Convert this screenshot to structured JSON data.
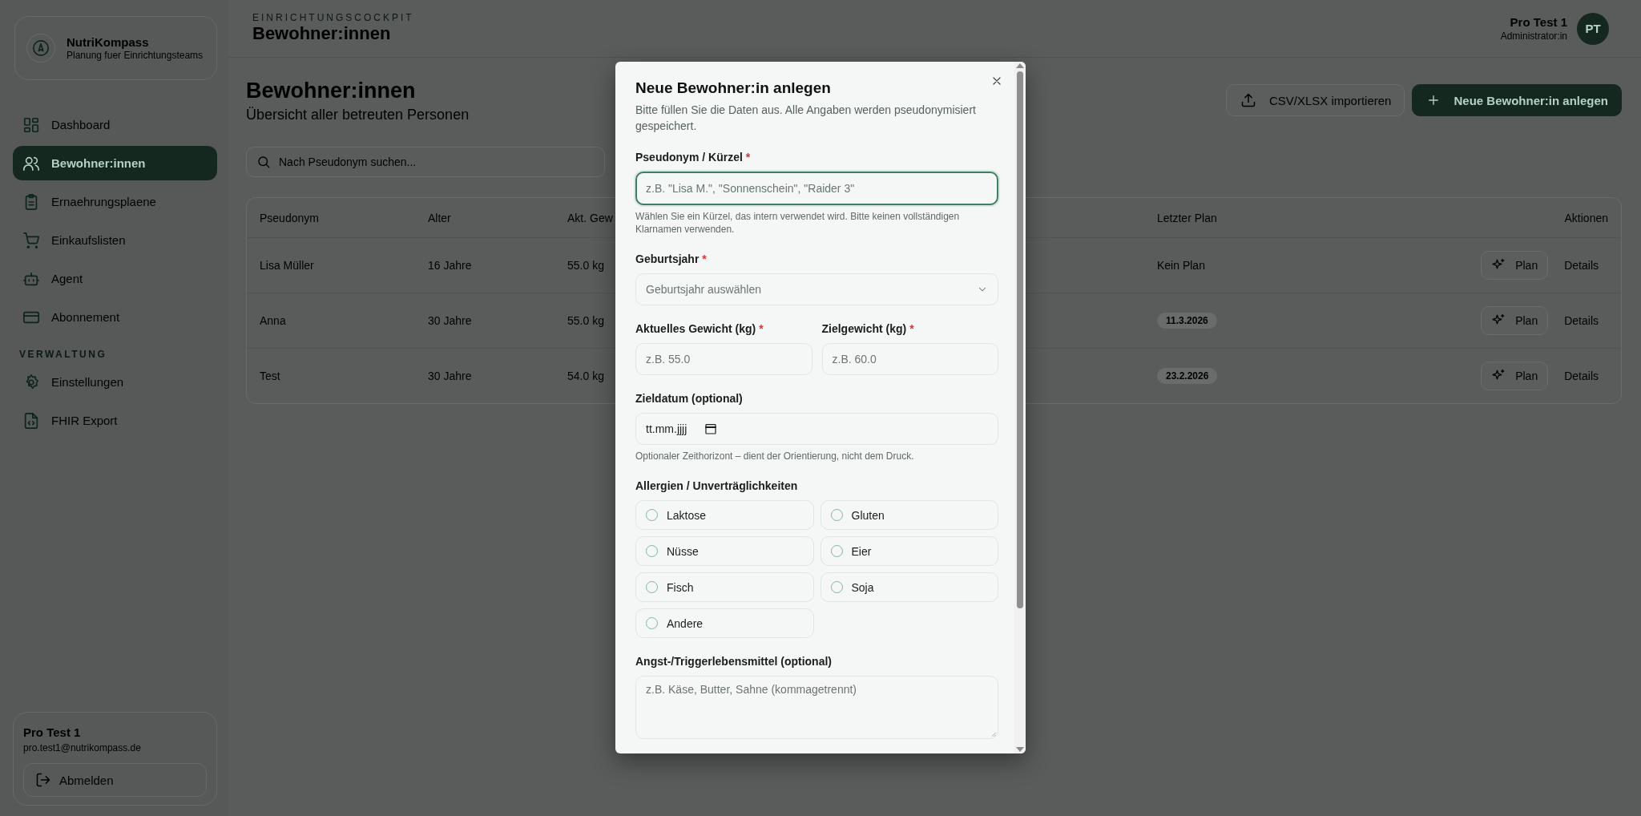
{
  "sidebar": {
    "brand": {
      "name": "NutriKompass",
      "tagline": "Planung fuer Einrichtungsteams"
    },
    "nav": [
      {
        "label": "Dashboard",
        "selected": false
      },
      {
        "label": "Bewohner:innen",
        "selected": true
      },
      {
        "label": "Ernaehrungsplaene",
        "selected": false
      },
      {
        "label": "Einkaufslisten",
        "selected": false
      },
      {
        "label": "Agent",
        "selected": false
      },
      {
        "label": "Abonnement",
        "selected": false
      }
    ],
    "section_label": "VERWALTUNG",
    "admin_nav": [
      {
        "label": "Einstellungen",
        "selected": false
      },
      {
        "label": "FHIR Export",
        "selected": false
      }
    ],
    "user": {
      "name": "Pro Test 1",
      "email": "pro.test1@nutrikompass.de"
    },
    "logout": "Abmelden"
  },
  "header": {
    "eyebrow": "EINRICHTUNGSCOCKPIT",
    "title": "Bewohner:innen",
    "user": {
      "name": "Pro Test 1",
      "role": "Administrator:in",
      "initials": "PT"
    }
  },
  "page": {
    "title": "Bewohner:innen",
    "subtitle": "Übersicht aller betreuten Personen",
    "actions": [
      {
        "label": "CSV/XLSX importieren",
        "kind": "secondary"
      },
      {
        "label": "Neue Bewohner:in anlegen",
        "kind": "primary"
      }
    ],
    "search": {
      "placeholder": "Nach Pseudonym suchen..."
    }
  },
  "table": {
    "columns": [
      "Pseudonym",
      "Alter",
      "Akt. Gew",
      "Letzter Plan",
      "Aktionen"
    ],
    "rows": [
      {
        "pseudonym": "Lisa Müller",
        "age": "16 Jahre",
        "weight": "55.0 kg",
        "last_plan": {
          "text": "Kein Plan",
          "kind": "plain"
        },
        "plan_button": "Plan",
        "details": "Details"
      },
      {
        "pseudonym": "Anna",
        "age": "30 Jahre",
        "weight": "55.0 kg",
        "last_plan": {
          "text": "11.3.2026",
          "kind": "badge"
        },
        "plan_button": "Plan",
        "details": "Details"
      },
      {
        "pseudonym": "Test",
        "age": "30 Jahre",
        "weight": "54.0 kg",
        "last_plan": {
          "text": "23.2.2026",
          "kind": "badge"
        },
        "plan_button": "Plan",
        "details": "Details"
      }
    ]
  },
  "dialog": {
    "title": "Neue Bewohner:in anlegen",
    "description": "Bitte füllen Sie die Daten aus. Alle Angaben werden pseudonymisiert gespeichert.",
    "fields": [
      {
        "kind": "text",
        "label": "Pseudonym / Kürzel",
        "required_mark": "*",
        "placeholder": "z.B. \"Lisa M.\", \"Sonnenschein\", \"Raider 3\"",
        "focused": true,
        "hint": "Wählen Sie ein Kürzel, das intern verwendet wird. Bitte keinen vollständigen Klarnamen verwenden."
      },
      {
        "kind": "select",
        "label": "Geburtsjahr",
        "required_mark": "*",
        "placeholder": "Geburtsjahr auswählen"
      },
      {
        "kind": "row",
        "fields": [
          {
            "kind": "text",
            "label": "Aktuelles Gewicht (kg)",
            "required_mark": "*",
            "placeholder": "z.B. 55.0",
            "focused": false
          },
          {
            "kind": "text",
            "label": "Zielgewicht (kg)",
            "required_mark": "*",
            "placeholder": "z.B. 60.0",
            "focused": false
          }
        ]
      },
      {
        "kind": "date",
        "label": "Zieldatum (optional)",
        "placeholder": "tt.mm.jjjj",
        "hint": "Optionaler Zeithorizont – dient der Orientierung, nicht dem Druck."
      },
      {
        "kind": "options",
        "label": "Allergien / Unverträglichkeiten",
        "options": [
          {
            "label": "Laktose",
            "checked": false
          },
          {
            "label": "Gluten",
            "checked": false
          },
          {
            "label": "Nüsse",
            "checked": false
          },
          {
            "label": "Eier",
            "checked": false
          },
          {
            "label": "Fisch",
            "checked": false
          },
          {
            "label": "Soja",
            "checked": false
          },
          {
            "label": "Andere",
            "checked": false
          }
        ]
      },
      {
        "kind": "textarea",
        "label": "Angst-/Triggerlebensmittel (optional)",
        "placeholder": "z.B. Käse, Butter, Sahne (kommagetrennt)"
      }
    ]
  }
}
